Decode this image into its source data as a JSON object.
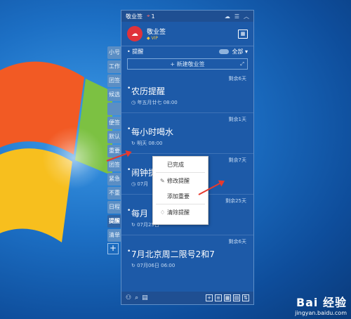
{
  "window": {
    "app_title": "敬业签",
    "count": "1"
  },
  "user": {
    "name": "敬业签",
    "vip": "VIP"
  },
  "section": {
    "label": "提醒",
    "filter": "全部"
  },
  "new_note_label": "+ 新建敬业签",
  "side_tabs": [
    "小号",
    "工作",
    "团签",
    "候选",
    "",
    "便签",
    "默认",
    "重要",
    "团签",
    "紧急",
    "不重",
    "日程",
    "提醒",
    "清单"
  ],
  "items": [
    {
      "remain": "剩余6天",
      "title": "农历提醒",
      "time": "年五月廿七 08:00"
    },
    {
      "remain": "剩余1天",
      "title": "每小时喝水",
      "time": "明天 08:00"
    },
    {
      "remain": "剩余7天",
      "title": "闹钟提",
      "time": "07月"
    },
    {
      "remain": "剩余25天",
      "title": "每月",
      "time": "07月25日"
    },
    {
      "remain": "剩余6天",
      "title": "7月北京周二限号2和7",
      "time": "07月06日 06:00"
    }
  ],
  "context_menu": {
    "items": [
      "已完成",
      "修改提醒",
      "添加重要",
      "清除提醒"
    ]
  },
  "watermark": {
    "brand": "Bai 经验",
    "url": "jingyan.baidu.com"
  },
  "colors": {
    "panel": "#1d5aa8",
    "accent_red": "#e63a2e",
    "vip_gold": "#f5c542"
  }
}
